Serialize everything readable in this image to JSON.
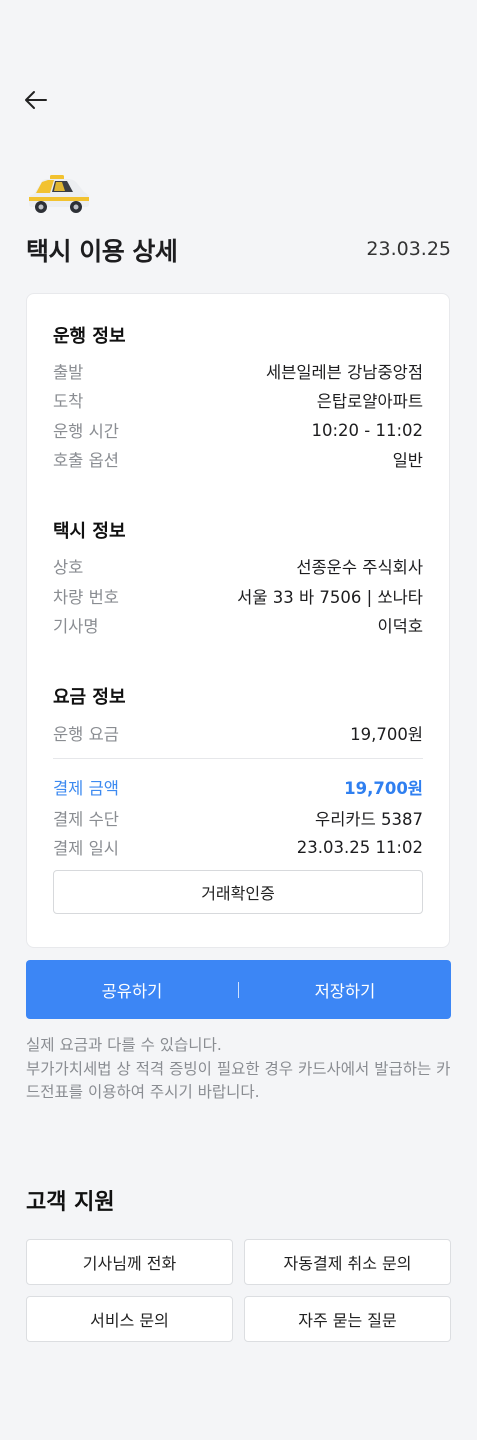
{
  "header": {
    "back_icon": "arrow-left-icon",
    "title": "택시 이용 상세",
    "date": "23.03.25"
  },
  "colors": {
    "accent": "#3c86f5",
    "taxi_yellow": "#f2c230"
  },
  "drive": {
    "title": "운행 정보",
    "rows": [
      {
        "label": "출발",
        "value": "세븐일레븐 강남중앙점"
      },
      {
        "label": "도착",
        "value": "은탑로얄아파트"
      },
      {
        "label": "운행 시간",
        "value": "10:20 - 11:02"
      },
      {
        "label": "호출 옵션",
        "value": "일반"
      }
    ]
  },
  "taxi": {
    "title": "택시 정보",
    "rows": [
      {
        "label": "상호",
        "value": "선종운수 주식회사"
      },
      {
        "label": "차량 번호",
        "value": "서울 33 바 7506 | 쏘나타"
      },
      {
        "label": "기사명",
        "value": "이덕호"
      }
    ]
  },
  "fare": {
    "title": "요금 정보",
    "fare_label": "운행 요금",
    "fare_value": "19,700원",
    "pay_label": "결제 금액",
    "pay_value": "19,700원",
    "method_label": "결제 수단",
    "method_value": "우리카드 5387",
    "datetime_label": "결제 일시",
    "datetime_value": "23.03.25 11:02",
    "receipt_button": "거래확인증"
  },
  "actions": {
    "share": "공유하기",
    "separator": "|",
    "save": "저장하기"
  },
  "note": {
    "line1": "실제 요금과 다를 수 있습니다.",
    "line2": "부가가치세법 상 적격 증빙이 필요한 경우 카드사에서 발급하는 카드전표를 이용하여 주시기 바랍니다."
  },
  "support": {
    "title": "고객 지원",
    "call_driver": "기사님께 전화",
    "cancel_autopay": "자동결제 취소 문의",
    "service_inquiry": "서비스 문의",
    "faq": "자주 묻는 질문"
  }
}
